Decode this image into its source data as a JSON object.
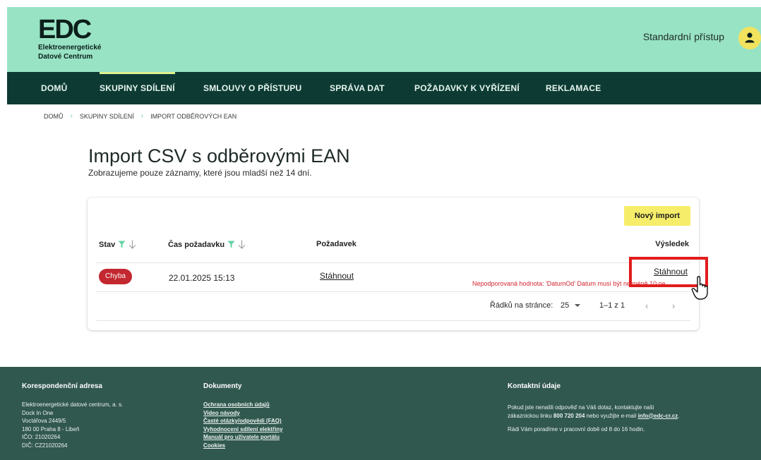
{
  "brand": {
    "logo_text": "EDC",
    "logo_line1": "Elektroenergetické",
    "logo_line2": "Datové Centrum"
  },
  "header": {
    "access_label": "Standardní přístup",
    "avatar_icon": "user-icon"
  },
  "nav": {
    "items": [
      {
        "label": "DOMŮ"
      },
      {
        "label": "SKUPINY SDÍLENÍ"
      },
      {
        "label": "SMLOUVY O PŘÍSTUPU"
      },
      {
        "label": "SPRÁVA DAT"
      },
      {
        "label": "POŽADAVKY K VYŘÍZENÍ"
      },
      {
        "label": "REKLAMACE"
      }
    ],
    "active_index": 1
  },
  "breadcrumb": [
    "DOMŮ",
    "SKUPINY SDÍLENÍ",
    "IMPORT ODBĚROVÝCH EAN"
  ],
  "page": {
    "title": "Import CSV s odběrovými EAN",
    "subtitle": "Zobrazujeme pouze záznamy, které jsou mladší než 14 dní."
  },
  "table": {
    "new_import_label": "Nový import",
    "columns": {
      "status": "Stav",
      "time": "Čas požadavku",
      "request": "Požadavek",
      "result": "Výsledek"
    },
    "rows": [
      {
        "status": "Chyba",
        "time": "22.01.2025 15:13",
        "request_link": "Stáhnout",
        "error": "Nepodporovaná hodnota: 'DatumOd' Datum musí být nejméně 10 ne",
        "result_link": "Stáhnout"
      }
    ],
    "pagination": {
      "rows_per_page_label": "Řádků na stránce:",
      "rows_per_page_value": "25",
      "range": "1–1 z 1",
      "prev": "‹",
      "next": "›"
    }
  },
  "footer": {
    "address": {
      "heading": "Korespondenční adresa",
      "lines": [
        "Elektroenergetické datové centrum, a. s.",
        "Dock In One",
        "Voctářova 2449/5",
        "180 00 Praha 8 - Libeň",
        "IČO: 21020264",
        "DIČ: CZ21020264"
      ]
    },
    "documents": {
      "heading": "Dokumenty",
      "links": [
        "Ochrana osobních údajů",
        "Video návody",
        "Časté otázky/odpovědi (FAQ)",
        "Vyhodnocení sdílení elektřiny",
        "Manuál pro uživatele portálu",
        "Cookies"
      ]
    },
    "contact": {
      "heading": "Kontaktní údaje",
      "p1_a": "Pokud jste nenašli odpověď na Váš dotaz, kontaktujte naši",
      "p1_b": "zákaznickou linku ",
      "phone": "800 720 204",
      "p1_c": " nebo využijte e-mail ",
      "email": "info@edc-cr.cz",
      "p1_d": ".",
      "p2": "Rádi Vám poradíme v pracovní době od 8 do 16 hodin."
    }
  },
  "colors": {
    "header_bg": "#98e3c4",
    "nav_bg": "#0d3b34",
    "footer_bg": "#31584f",
    "accent_yellow": "#f6ee6a",
    "error_red": "#c3272f",
    "filter_green": "#5fd29f"
  }
}
